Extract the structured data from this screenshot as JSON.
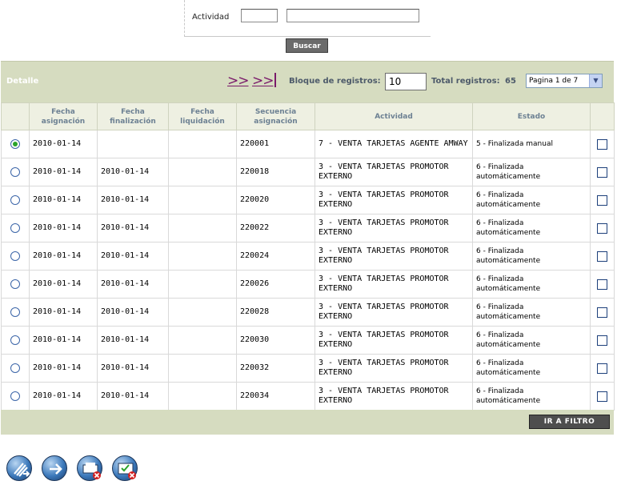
{
  "filter": {
    "actividad_label": "Actividad",
    "actividad_code": "",
    "actividad_desc": "",
    "buscar_label": "Buscar"
  },
  "detail": {
    "title": "Detalle",
    "nav_next": ">>",
    "nav_last": ">>",
    "block_label": "Bloque de registros:",
    "block_value": "10",
    "total_label": "Total registros:",
    "total_value": "65",
    "page_select": "Pagina 1 de 7"
  },
  "table": {
    "headers": [
      "",
      "Fecha asignación",
      "Fecha finalización",
      "Fecha liquidación",
      "Secuencia asignación",
      "Actividad",
      "Estado",
      ""
    ],
    "rows": [
      {
        "selected": true,
        "fecha_asignacion": "2010-01-14",
        "fecha_finalizacion": "",
        "fecha_liquidacion": "",
        "secuencia": "220001",
        "actividad": "7 - VENTA TARJETAS AGENTE AMWAY",
        "estado": "5 - Finalizada manual"
      },
      {
        "selected": false,
        "fecha_asignacion": "2010-01-14",
        "fecha_finalizacion": "2010-01-14",
        "fecha_liquidacion": "",
        "secuencia": "220018",
        "actividad": "3 - VENTA TARJETAS PROMOTOR EXTERNO",
        "estado": "6 - Finalizada automáticamente"
      },
      {
        "selected": false,
        "fecha_asignacion": "2010-01-14",
        "fecha_finalizacion": "2010-01-14",
        "fecha_liquidacion": "",
        "secuencia": "220020",
        "actividad": "3 - VENTA TARJETAS PROMOTOR EXTERNO",
        "estado": "6 - Finalizada automáticamente"
      },
      {
        "selected": false,
        "fecha_asignacion": "2010-01-14",
        "fecha_finalizacion": "2010-01-14",
        "fecha_liquidacion": "",
        "secuencia": "220022",
        "actividad": "3 - VENTA TARJETAS PROMOTOR EXTERNO",
        "estado": "6 - Finalizada automáticamente"
      },
      {
        "selected": false,
        "fecha_asignacion": "2010-01-14",
        "fecha_finalizacion": "2010-01-14",
        "fecha_liquidacion": "",
        "secuencia": "220024",
        "actividad": "3 - VENTA TARJETAS PROMOTOR EXTERNO",
        "estado": "6 - Finalizada automáticamente"
      },
      {
        "selected": false,
        "fecha_asignacion": "2010-01-14",
        "fecha_finalizacion": "2010-01-14",
        "fecha_liquidacion": "",
        "secuencia": "220026",
        "actividad": "3 - VENTA TARJETAS PROMOTOR EXTERNO",
        "estado": "6 - Finalizada automáticamente"
      },
      {
        "selected": false,
        "fecha_asignacion": "2010-01-14",
        "fecha_finalizacion": "2010-01-14",
        "fecha_liquidacion": "",
        "secuencia": "220028",
        "actividad": "3 - VENTA TARJETAS PROMOTOR EXTERNO",
        "estado": "6 - Finalizada automáticamente"
      },
      {
        "selected": false,
        "fecha_asignacion": "2010-01-14",
        "fecha_finalizacion": "2010-01-14",
        "fecha_liquidacion": "",
        "secuencia": "220030",
        "actividad": "3 - VENTA TARJETAS PROMOTOR EXTERNO",
        "estado": "6 - Finalizada automáticamente"
      },
      {
        "selected": false,
        "fecha_asignacion": "2010-01-14",
        "fecha_finalizacion": "2010-01-14",
        "fecha_liquidacion": "",
        "secuencia": "220032",
        "actividad": "3 - VENTA TARJETAS PROMOTOR EXTERNO",
        "estado": "6 - Finalizada automáticamente"
      },
      {
        "selected": false,
        "fecha_asignacion": "2010-01-14",
        "fecha_finalizacion": "2010-01-14",
        "fecha_liquidacion": "",
        "secuencia": "220034",
        "actividad": "3 - VENTA TARJETAS PROMOTOR EXTERNO",
        "estado": "6 - Finalizada automáticamente"
      }
    ]
  },
  "footer": {
    "ir_filtro_label": "IR A FILTRO"
  },
  "actions": [
    {
      "icon": "new-record-icon"
    },
    {
      "icon": "forward-icon"
    },
    {
      "icon": "delete-printer-icon"
    },
    {
      "icon": "delete-check-icon"
    }
  ],
  "colors": {
    "header_bar": "#d6dcc0",
    "nav_link": "#7a1a6a",
    "label_text": "#4d5a6a",
    "button_dark": "#4e4e4e"
  }
}
